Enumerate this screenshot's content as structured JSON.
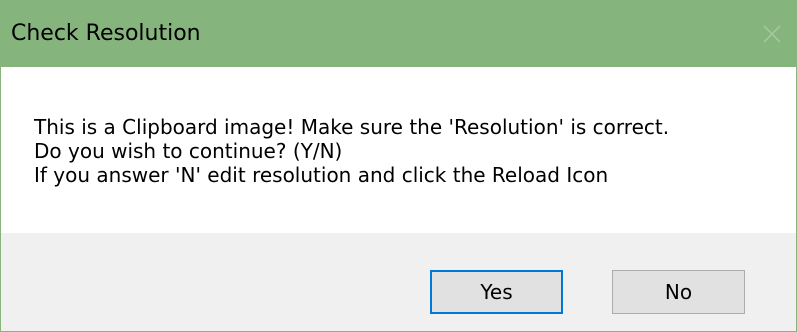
{
  "dialog": {
    "title": "Check Resolution",
    "close_icon": "close-icon",
    "message_lines": [
      "This is a Clipboard image! Make sure the 'Resolution' is correct.",
      "Do you wish to continue? (Y/N)",
      "If you answer 'N' edit resolution and click the Reload Icon"
    ],
    "buttons": {
      "yes_label": "Yes",
      "no_label": "No"
    }
  },
  "colors": {
    "titlebar": "#86b47d",
    "footer": "#f0f0f0",
    "button_face": "#e1e1e1",
    "focus_border": "#0078d7"
  }
}
